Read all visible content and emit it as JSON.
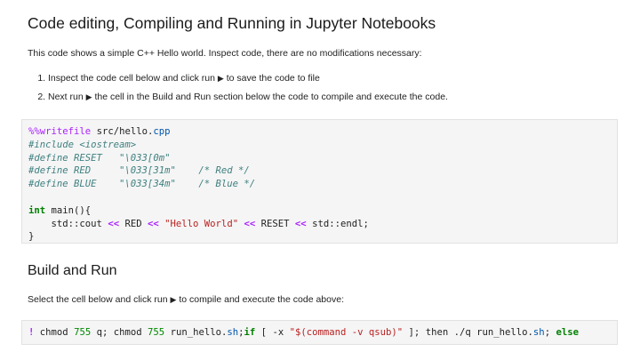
{
  "title": "Code editing, Compiling and Running in Jupyter Notebooks",
  "intro": "This code shows a simple C++ Hello world. Inspect code, there are no modifications necessary:",
  "steps": [
    {
      "before": "Inspect the code cell below and click run",
      "icon": "play-triangle-icon",
      "after": "to save the code to file"
    },
    {
      "before": "Next run",
      "icon": "play-triangle-icon",
      "after": "the cell in the Build and Run section below the code to compile and execute the code."
    }
  ],
  "code_cell": {
    "magic": "%%writefile",
    "file_prefix": "src/hello.",
    "file_ext": "cpp",
    "include": "#include <iostream>",
    "define_reset": "#define RESET   \"\\033[0m\"",
    "define_red_code": "#define RED     \"\\033[31m\"",
    "define_red_comment": "/* Red */",
    "define_blue_code": "#define BLUE    \"\\033[34m\"",
    "define_blue_comment": "/* Blue */",
    "int_kw": "int",
    "main_sig": "main(){",
    "cout": "std::cout",
    "op": "<<",
    "red": "RED",
    "hello_str": "\"Hello World\"",
    "reset": "RESET",
    "endl": "std::endl;",
    "close_brace": "}"
  },
  "section_title": "Build and Run",
  "build_note": {
    "before": "Select the cell below and click run",
    "icon": "play-triangle-icon",
    "after": "to compile and execute the code above:"
  },
  "shell_cell": {
    "bang": "!",
    "chmod": "chmod",
    "mode": "755",
    "q": "q;",
    "run_prefix": "run_hello.",
    "sh": "sh",
    "semi": ";",
    "if_kw": "if",
    "bracket_open": "[",
    "flag": "-x",
    "subst": "\"$(command -v qsub)\"",
    "bracket_close": "];",
    "then_kw": "then",
    "qrun": "./q",
    "run_name": "run_hello.",
    "else_kw": "else"
  },
  "triangle_glyph": "▶"
}
